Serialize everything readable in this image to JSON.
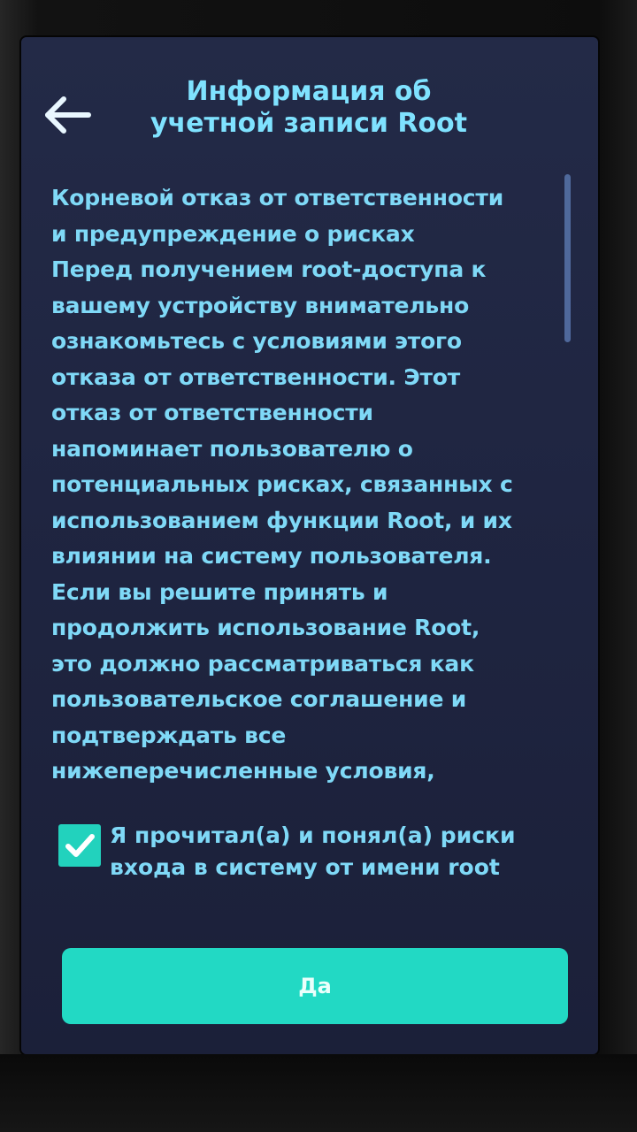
{
  "header": {
    "back_icon": "arrow-left-icon",
    "title_line1": "Информация об",
    "title_line2": "учетной записи Root"
  },
  "disclaimer": {
    "text": "Корневой отказ от ответственности\nи предупреждение о рисках\nПеред получением root-доступа к\nвашему устройству внимательно\nознакомьтесь с условиями этого\nотказа от ответственности. Этот\nотказ от ответственности\nнапоминает пользователю о\nпотенциальных рисках, связанных с\nиспользованием функции Root, и их\nвлиянии на систему пользователя.\nЕсли вы решите принять и\nпродолжить использование Root,\nэто должно рассматриваться как\nпользовательское соглашение и\nподтверждать все\nнижеперечисленные условия,"
  },
  "consent": {
    "checked": true,
    "label": "Я прочитал(а) и понял(а) риски входа в систему от имени root",
    "check_icon": "checkmark-icon"
  },
  "actions": {
    "confirm_label": "Да"
  },
  "colors": {
    "accent": "#22d9c4",
    "text": "#7fd9f7",
    "background": "#1f2541"
  }
}
